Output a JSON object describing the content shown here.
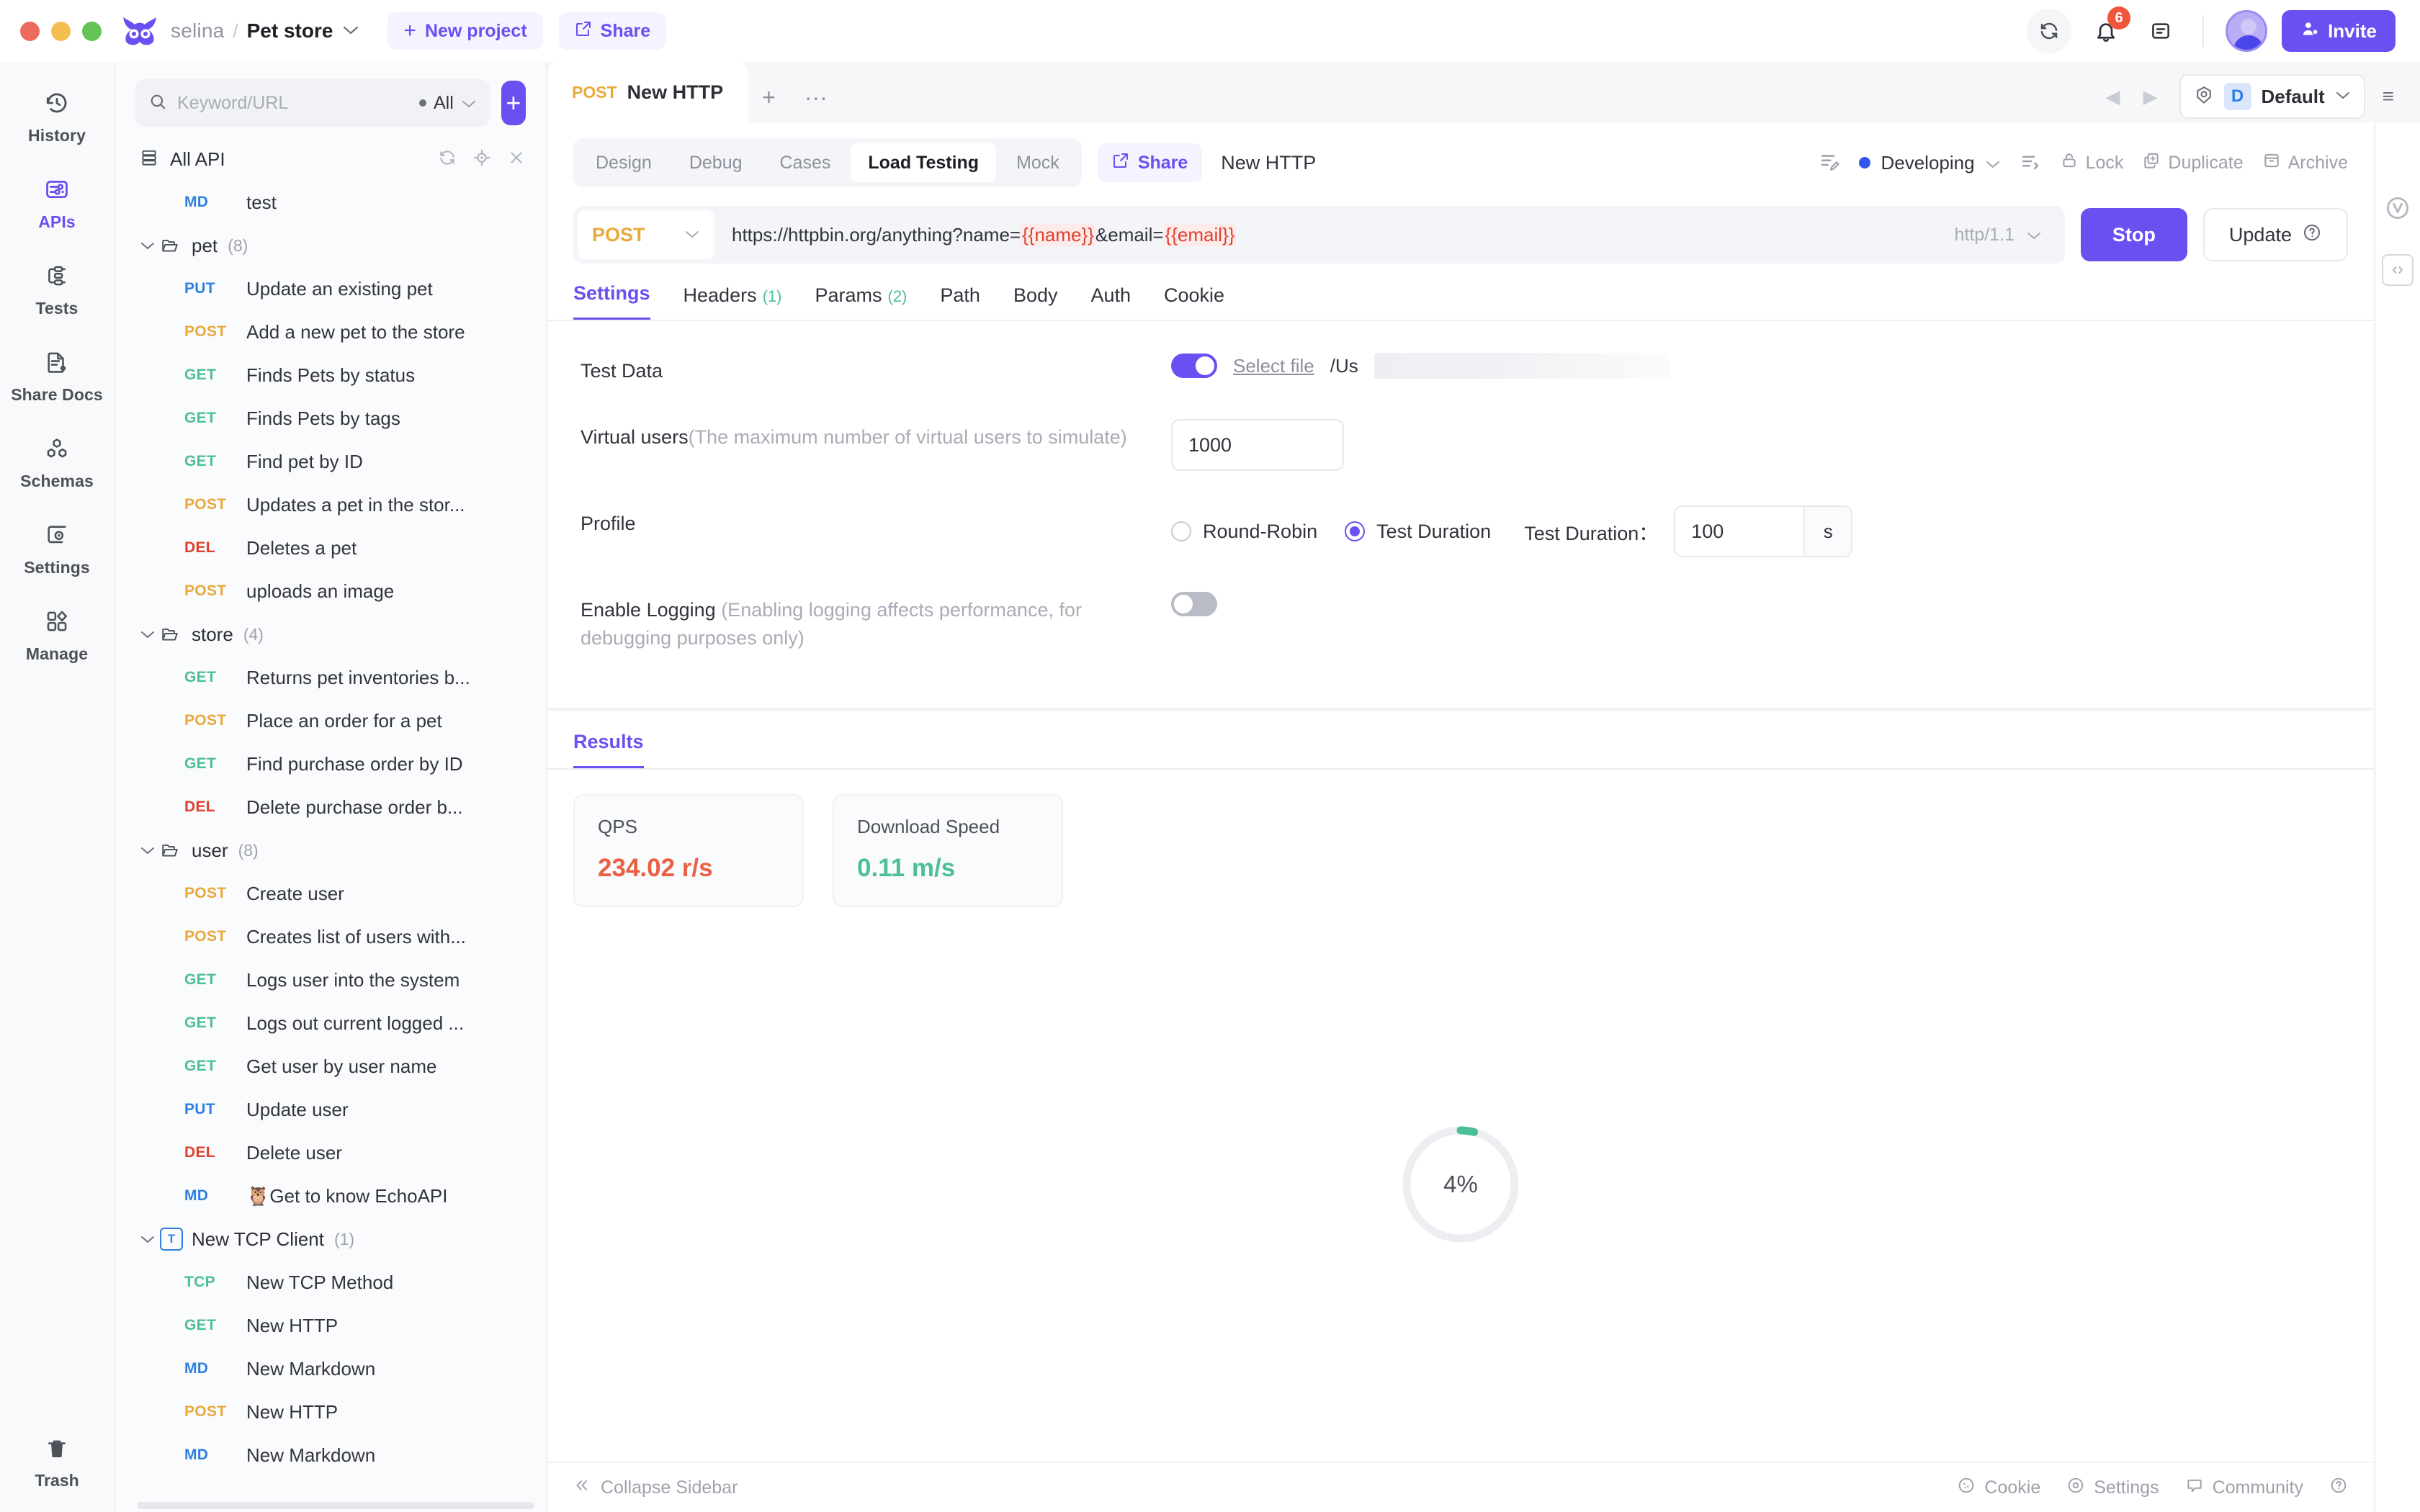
{
  "topbar": {
    "owner": "selina",
    "separator": "/",
    "project": "Pet store",
    "new_project": "New project",
    "share": "Share",
    "notification_count": "6",
    "invite": "Invite"
  },
  "rail": {
    "items": [
      {
        "label": "History",
        "icon": "history-icon",
        "active": false
      },
      {
        "label": "APIs",
        "icon": "apis-icon",
        "active": true
      },
      {
        "label": "Tests",
        "icon": "tests-icon",
        "active": false
      },
      {
        "label": "Share Docs",
        "icon": "share-docs-icon",
        "active": false
      },
      {
        "label": "Schemas",
        "icon": "schemas-icon",
        "active": false
      },
      {
        "label": "Settings",
        "icon": "settings-icon",
        "active": false
      },
      {
        "label": "Manage",
        "icon": "manage-icon",
        "active": false
      }
    ],
    "trash": "Trash"
  },
  "sidebar": {
    "search_placeholder": "Keyword/URL",
    "search_value": "",
    "filter": "All",
    "all_api": "All API",
    "tree": [
      {
        "kind": "item",
        "method": "MD",
        "name": "test",
        "indent": 1
      },
      {
        "kind": "folder",
        "name": "pet",
        "count": "(8)"
      },
      {
        "kind": "item",
        "method": "PUT",
        "name": "Update an existing pet",
        "indent": 2
      },
      {
        "kind": "item",
        "method": "POST",
        "name": "Add a new pet to the store",
        "indent": 2
      },
      {
        "kind": "item",
        "method": "GET",
        "name": "Finds Pets by status",
        "indent": 2
      },
      {
        "kind": "item",
        "method": "GET",
        "name": "Finds Pets by tags",
        "indent": 2
      },
      {
        "kind": "item",
        "method": "GET",
        "name": "Find pet by ID",
        "indent": 2
      },
      {
        "kind": "item",
        "method": "POST",
        "name": "Updates a pet in the stor...",
        "indent": 2
      },
      {
        "kind": "item",
        "method": "DEL",
        "name": "Deletes a pet",
        "indent": 2
      },
      {
        "kind": "item",
        "method": "POST",
        "name": "uploads an image",
        "indent": 2
      },
      {
        "kind": "folder",
        "name": "store",
        "count": "(4)"
      },
      {
        "kind": "item",
        "method": "GET",
        "name": "Returns pet inventories b...",
        "indent": 2
      },
      {
        "kind": "item",
        "method": "POST",
        "name": "Place an order for a pet",
        "indent": 2
      },
      {
        "kind": "item",
        "method": "GET",
        "name": "Find purchase order by ID",
        "indent": 2
      },
      {
        "kind": "item",
        "method": "DEL",
        "name": "Delete purchase order b...",
        "indent": 2
      },
      {
        "kind": "folder",
        "name": "user",
        "count": "(8)"
      },
      {
        "kind": "item",
        "method": "POST",
        "name": "Create user",
        "indent": 2
      },
      {
        "kind": "item",
        "method": "POST",
        "name": "Creates list of users with...",
        "indent": 2
      },
      {
        "kind": "item",
        "method": "GET",
        "name": "Logs user into the system",
        "indent": 2
      },
      {
        "kind": "item",
        "method": "GET",
        "name": "Logs out current logged ...",
        "indent": 2
      },
      {
        "kind": "item",
        "method": "GET",
        "name": "Get user by user name",
        "indent": 2
      },
      {
        "kind": "item",
        "method": "PUT",
        "name": "Update user",
        "indent": 2
      },
      {
        "kind": "item",
        "method": "DEL",
        "name": "Delete user",
        "indent": 2
      },
      {
        "kind": "item",
        "method": "MD",
        "name": "🦉Get to know EchoAPI",
        "indent": 2
      },
      {
        "kind": "tcpfolder",
        "name": "New TCP Client",
        "count": "(1)"
      },
      {
        "kind": "item",
        "method": "TCP",
        "name": "New TCP Method",
        "indent": 2
      },
      {
        "kind": "item",
        "method": "GET",
        "name": "New HTTP",
        "indent": 1
      },
      {
        "kind": "item",
        "method": "MD",
        "name": "New Markdown",
        "indent": 1
      },
      {
        "kind": "item",
        "method": "POST",
        "name": "New HTTP",
        "indent": 1
      },
      {
        "kind": "item",
        "method": "MD",
        "name": "New Markdown",
        "indent": 1
      }
    ]
  },
  "doctab": {
    "method": "POST",
    "name": "New HTTP"
  },
  "env": {
    "badge": "D",
    "name": "Default"
  },
  "request_header": {
    "tabs": [
      {
        "label": "Design",
        "active": false
      },
      {
        "label": "Debug",
        "active": false
      },
      {
        "label": "Cases",
        "active": false
      },
      {
        "label": "Load Testing",
        "active": true
      },
      {
        "label": "Mock",
        "active": false
      }
    ],
    "share": "Share",
    "title": "New HTTP",
    "status": "Developing",
    "actions": [
      {
        "label": "Lock",
        "icon": "lock-icon"
      },
      {
        "label": "Duplicate",
        "icon": "duplicate-icon"
      },
      {
        "label": "Archive",
        "icon": "archive-icon"
      }
    ]
  },
  "url_row": {
    "method": "POST",
    "url_prefix": "https://httpbin.org/anything?name=",
    "url_var1": "{{name}}",
    "url_mid": "&email=",
    "url_var2": "{{email}}",
    "http_version": "http/1.1",
    "stop": "Stop",
    "update": "Update"
  },
  "sub_tabs": [
    {
      "label": "Settings",
      "count": "",
      "active": true
    },
    {
      "label": "Headers",
      "count": "(1)",
      "active": false
    },
    {
      "label": "Params",
      "count": "(2)",
      "active": false
    },
    {
      "label": "Path",
      "count": "",
      "active": false
    },
    {
      "label": "Body",
      "count": "",
      "active": false
    },
    {
      "label": "Auth",
      "count": "",
      "active": false
    },
    {
      "label": "Cookie",
      "count": "",
      "active": false
    }
  ],
  "settings": {
    "test_data_label": "Test Data",
    "test_data_enabled": true,
    "select_file": "Select file",
    "file_path": "/Us",
    "virtual_users_label": "Virtual users",
    "virtual_users_hint": "(The maximum number of virtual users to simulate)",
    "virtual_users_value": "1000",
    "profile_label": "Profile",
    "profile_round_robin": "Round-Robin",
    "profile_test_duration": "Test Duration",
    "profile_selected": "Test Duration",
    "test_duration_label": "Test Duration：",
    "test_duration_value": "100",
    "test_duration_unit": "s",
    "enable_logging_label": "Enable Logging",
    "enable_logging_hint": "(Enabling logging affects performance, for debugging purposes only)",
    "enable_logging_enabled": false
  },
  "results": {
    "tab": "Results",
    "cards": [
      {
        "title": "QPS",
        "value": "234.02 r/s",
        "color": "#ea5f42"
      },
      {
        "title": "Download Speed",
        "value": "0.11 m/s",
        "color": "#4cbf9a"
      }
    ],
    "progress_percent": "4%",
    "progress_value": 4,
    "progress_color": "#4cbf9a"
  },
  "statusbar": {
    "collapse": "Collapse Sidebar",
    "items": [
      {
        "label": "Cookie",
        "icon": "cookie-icon"
      },
      {
        "label": "Settings",
        "icon": "settings-gear-icon"
      },
      {
        "label": "Community",
        "icon": "community-icon"
      }
    ]
  },
  "colors": {
    "accent": "#6c4ff0",
    "get": "#4cbf9a",
    "post": "#e8a93a",
    "put": "#2f7fe0",
    "del": "#e0402f"
  }
}
